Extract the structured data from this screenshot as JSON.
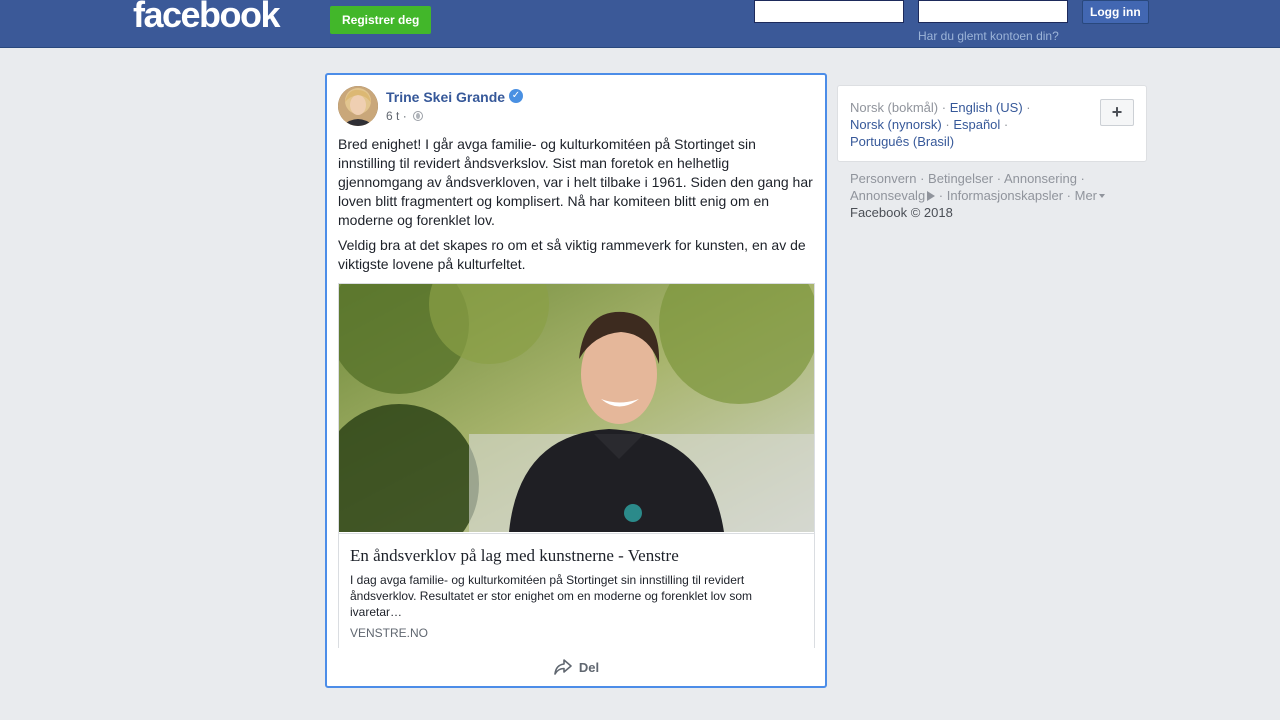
{
  "topbar": {
    "logo": "facebook",
    "register_label": "Registrer deg",
    "login_label": "Logg inn",
    "forgot_label": "Har du glemt kontoen din?",
    "email_value": "",
    "password_value": ""
  },
  "post": {
    "author": "Trine Skei Grande",
    "verified_icon": "verified-badge-icon",
    "time": "6 t",
    "separator": "·",
    "paragraphs": [
      "Bred enighet! I går avga familie- og kulturkomitéen på Stortinget sin innstilling til revidert åndsverkslov. Sist man foretok en helhetlig gjennomgang av åndsverkloven, var i helt tilbake i 1961. Siden den gang har loven blitt fragmentert og komplisert. Nå har komiteen blitt enig om en moderne og forenklet lov.",
      "Veldig bra at det skapes ro om et så viktig rammeverk for kunsten, en av de viktigste lovene på kulturfeltet."
    ],
    "link": {
      "title": "En åndsverklov på lag med kunstnerne - Venstre",
      "description": "I dag avga familie- og kulturkomitéen på Stortinget sin innstilling til revidert åndsverklov. Resultatet er stor enighet om en moderne og forenklet lov som ivaretar…",
      "domain": "VENSTRE.NO"
    },
    "share_label": "Del"
  },
  "languages": {
    "current": "Norsk (bokmål)",
    "options": [
      "English (US)",
      "Norsk (nynorsk)",
      "Español",
      "Português (Brasil)"
    ],
    "add_label": "+"
  },
  "footer": {
    "links": [
      "Personvern",
      "Betingelser",
      "Annonsering",
      "Annonsevalg",
      "Informasjonskapsler",
      "Mer"
    ],
    "copyright": "Facebook © 2018"
  },
  "colors": {
    "topbar": "#3b5998",
    "register": "#42b72a",
    "link": "#365899",
    "focus_border": "#4c8de8"
  }
}
